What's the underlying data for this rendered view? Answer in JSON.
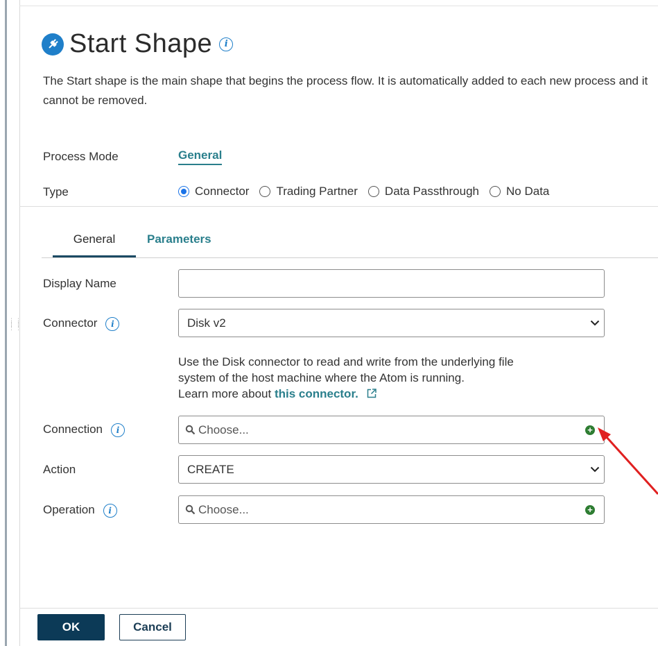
{
  "dialog": {
    "title": "Start Shape",
    "description": "The Start shape is the main shape that begins the process flow. It is automatically added to each new process and it cannot be removed."
  },
  "process_mode": {
    "label": "Process Mode",
    "value": "General"
  },
  "type": {
    "label": "Type",
    "options": [
      "Connector",
      "Trading Partner",
      "Data Passthrough",
      "No Data"
    ],
    "selected": "Connector"
  },
  "tabs": [
    {
      "label": "General",
      "active": true
    },
    {
      "label": "Parameters",
      "active": false
    }
  ],
  "fields": {
    "display_name": {
      "label": "Display Name",
      "value": ""
    },
    "connector": {
      "label": "Connector",
      "value": "Disk v2"
    },
    "connection": {
      "label": "Connection",
      "placeholder": "Choose..."
    },
    "action": {
      "label": "Action",
      "value": "CREATE"
    },
    "operation": {
      "label": "Operation",
      "placeholder": "Choose..."
    }
  },
  "connector_help": {
    "text_line1": "Use the Disk connector to read and write from the underlying file",
    "text_line2": "system of the host machine where the Atom is running.",
    "learn_prefix": "Learn more about",
    "link_text": "this connector."
  },
  "footer": {
    "ok_label": "OK",
    "cancel_label": "Cancel"
  },
  "colors": {
    "accent_teal": "#2a7f8c",
    "primary_button": "#0c3a57",
    "add_green": "#2e7d32",
    "annotation_red": "#e02020"
  },
  "icons": [
    "plug-icon",
    "info-icon",
    "chevron-down-icon",
    "search-icon",
    "add-icon",
    "external-link-icon"
  ]
}
